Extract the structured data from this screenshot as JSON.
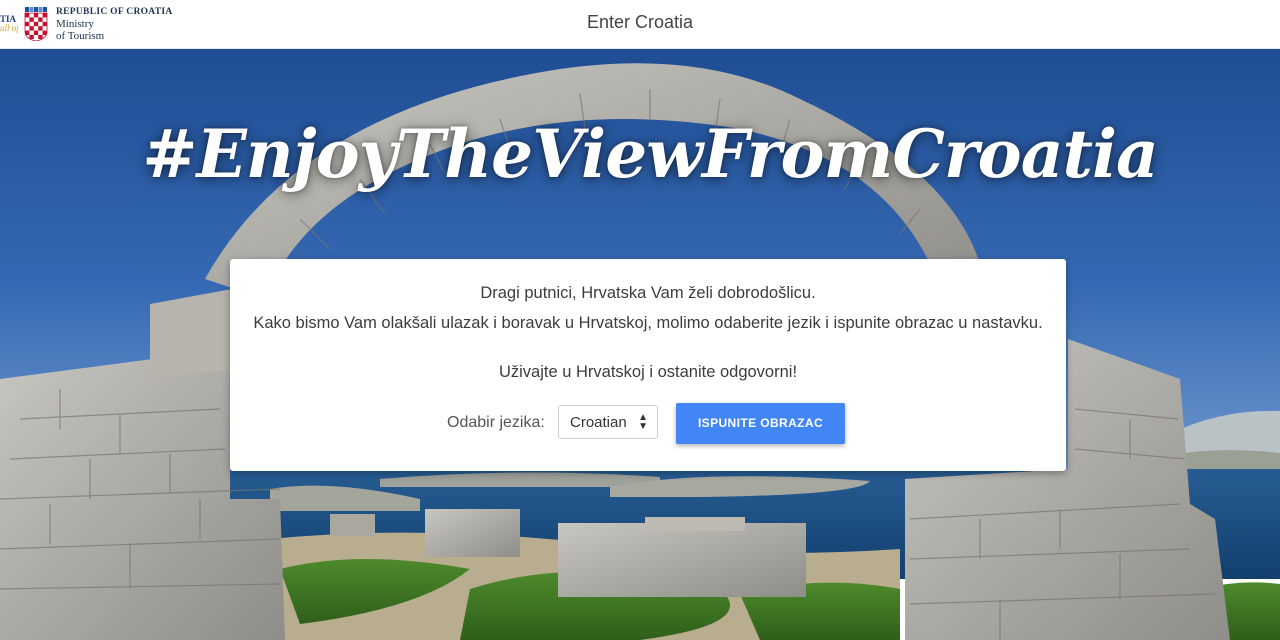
{
  "header": {
    "logo_partial_line1": "TIA",
    "logo_partial_line2": "ull of life",
    "ministry_line1": "REPUBLIC OF CROATIA",
    "ministry_line2": "Ministry",
    "ministry_line3": "of Tourism",
    "title": "Enter Croatia"
  },
  "hero": {
    "hashtag": "#EnjoyTheViewFromCroatia"
  },
  "card": {
    "greeting": "Dragi putnici, Hrvatska Vam želi dobrodošlicu.",
    "intro": "Kako bismo Vam olakšali ulazak i boravak u Hrvatskoj, molimo odaberite jezik i ispunite obrazac u nastavku.",
    "enjoy": "Uživajte u Hrvatskoj i ostanite odgovorni!",
    "language_label": "Odabir jezika:",
    "language_selected": "Croatian",
    "submit_label": "ISPUNITE OBRAZAC"
  },
  "colors": {
    "primary_button": "#4285f4",
    "sky": "#2c5aa0",
    "sea": "#1d4f86",
    "ministry_text": "#1f3256"
  }
}
